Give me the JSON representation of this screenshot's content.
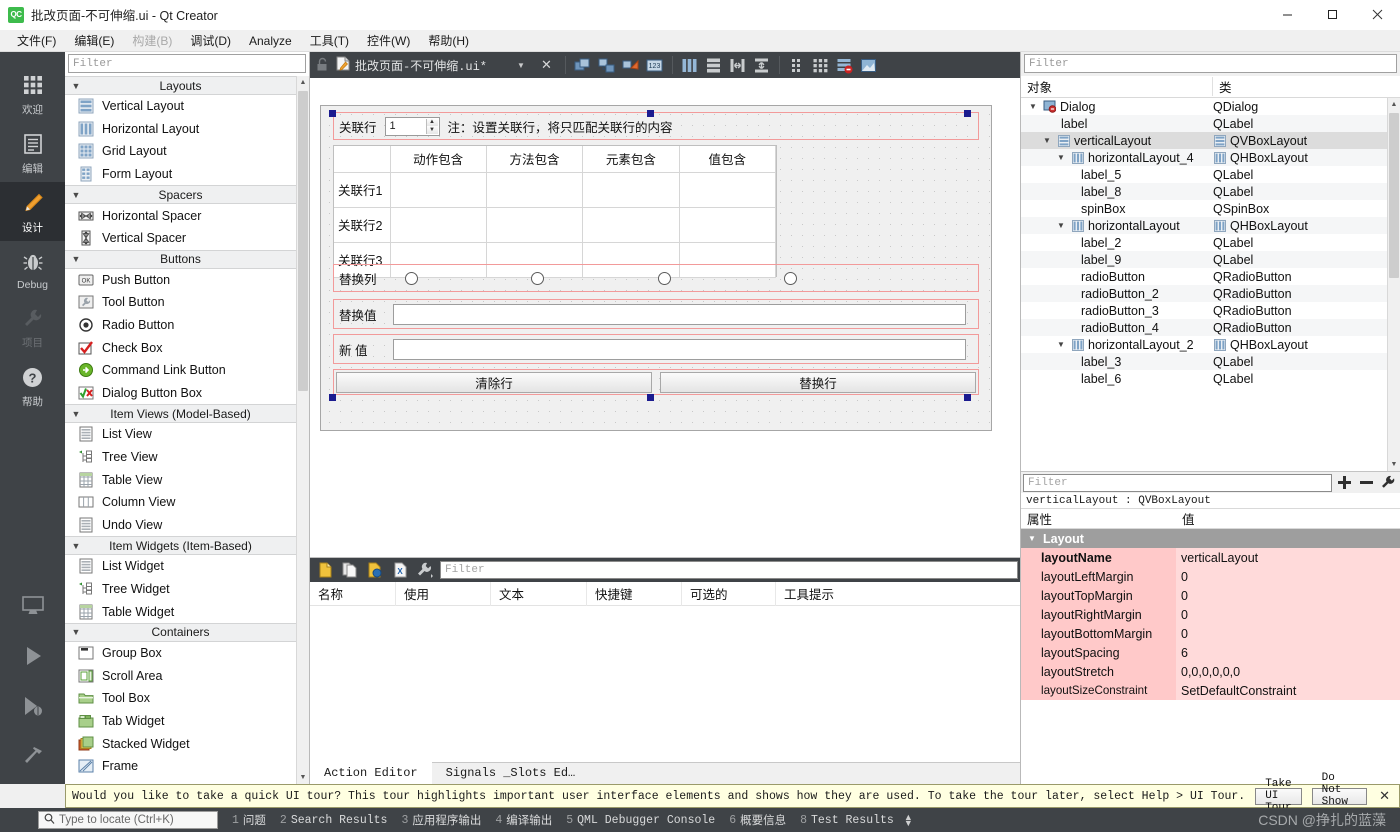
{
  "window": {
    "title": "批改页面-不可伸缩.ui - Qt Creator",
    "app_icon": "qt-creator-icon",
    "minimize": "—",
    "maximize": "▢",
    "close": "✕"
  },
  "menubar": {
    "items": [
      {
        "label": "文件(F)",
        "disabled": false
      },
      {
        "label": "编辑(E)",
        "disabled": false
      },
      {
        "label": "构建(B)",
        "disabled": true
      },
      {
        "label": "调试(D)",
        "disabled": false
      },
      {
        "label": "Analyze",
        "disabled": false
      },
      {
        "label": "工具(T)",
        "disabled": false
      },
      {
        "label": "控件(W)",
        "disabled": false
      },
      {
        "label": "帮助(H)",
        "disabled": false
      }
    ]
  },
  "modebar": {
    "items": [
      {
        "label": "欢迎",
        "icon": "grid-icon",
        "state": "normal"
      },
      {
        "label": "编辑",
        "icon": "document-icon",
        "state": "normal"
      },
      {
        "label": "设计",
        "icon": "pencil-icon",
        "state": "active"
      },
      {
        "label": "Debug",
        "icon": "bug-icon",
        "state": "normal"
      },
      {
        "label": "项目",
        "icon": "wrench-icon",
        "state": "disabled"
      },
      {
        "label": "帮助",
        "icon": "question-icon",
        "state": "normal"
      }
    ],
    "bottom": [
      {
        "icon": "kit-monitor-icon",
        "label": "kit-selector"
      },
      {
        "icon": "run-play-icon",
        "label": "run"
      },
      {
        "icon": "debug-play-icon",
        "label": "start-debugging"
      },
      {
        "icon": "hammer-icon",
        "label": "build"
      }
    ]
  },
  "widget_box": {
    "filter_placeholder": "Filter",
    "filter_value": "",
    "categories": [
      {
        "name": "Layouts",
        "expanded": true,
        "items": [
          {
            "label": "Vertical Layout",
            "icon": "vertical-layout-icon"
          },
          {
            "label": "Horizontal Layout",
            "icon": "horizontal-layout-icon"
          },
          {
            "label": "Grid Layout",
            "icon": "grid-layout-icon"
          },
          {
            "label": "Form Layout",
            "icon": "form-layout-icon"
          }
        ]
      },
      {
        "name": "Spacers",
        "expanded": true,
        "items": [
          {
            "label": "Horizontal Spacer",
            "icon": "horizontal-spacer-icon"
          },
          {
            "label": "Vertical Spacer",
            "icon": "vertical-spacer-icon"
          }
        ]
      },
      {
        "name": "Buttons",
        "expanded": true,
        "items": [
          {
            "label": "Push Button",
            "icon": "push-button-icon"
          },
          {
            "label": "Tool Button",
            "icon": "tool-button-icon"
          },
          {
            "label": "Radio Button",
            "icon": "radio-button-icon"
          },
          {
            "label": "Check Box",
            "icon": "check-box-icon"
          },
          {
            "label": "Command Link Button",
            "icon": "command-link-icon"
          },
          {
            "label": "Dialog Button Box",
            "icon": "dialog-button-box-icon"
          }
        ]
      },
      {
        "name": "Item Views (Model-Based)",
        "expanded": true,
        "items": [
          {
            "label": "List View",
            "icon": "list-view-icon"
          },
          {
            "label": "Tree View",
            "icon": "tree-view-icon"
          },
          {
            "label": "Table View",
            "icon": "table-view-icon"
          },
          {
            "label": "Column View",
            "icon": "column-view-icon"
          },
          {
            "label": "Undo View",
            "icon": "undo-view-icon"
          }
        ]
      },
      {
        "name": "Item Widgets (Item-Based)",
        "expanded": true,
        "items": [
          {
            "label": "List Widget",
            "icon": "list-widget-icon"
          },
          {
            "label": "Tree Widget",
            "icon": "tree-widget-icon"
          },
          {
            "label": "Table Widget",
            "icon": "table-widget-icon"
          }
        ]
      },
      {
        "name": "Containers",
        "expanded": true,
        "items": [
          {
            "label": "Group Box",
            "icon": "group-box-icon"
          },
          {
            "label": "Scroll Area",
            "icon": "scroll-area-icon"
          },
          {
            "label": "Tool Box",
            "icon": "tool-box-icon"
          },
          {
            "label": "Tab Widget",
            "icon": "tab-widget-icon"
          },
          {
            "label": "Stacked Widget",
            "icon": "stacked-widget-icon"
          },
          {
            "label": "Frame",
            "icon": "frame-icon"
          }
        ]
      }
    ]
  },
  "doc_toolbar": {
    "lock_icon": "unlocked-icon",
    "file_icon": "ui-file-icon",
    "filename": "批改页面-不可伸缩.ui*",
    "dropdown_icon": "chevron-down-icon",
    "close_icon": "close-icon",
    "tools": [
      {
        "icon": "edit-widgets-icon",
        "name": "edit-widgets"
      },
      {
        "icon": "edit-signals-slots-icon",
        "name": "edit-signals-slots"
      },
      {
        "icon": "edit-buddies-icon",
        "name": "edit-buddies"
      },
      {
        "icon": "edit-tab-order-icon",
        "name": "edit-tab-order"
      },
      {
        "icon": "layout-horizontally-icon",
        "name": "lay-out-horizontally"
      },
      {
        "icon": "layout-vertically-icon",
        "name": "lay-out-vertically"
      },
      {
        "icon": "layout-splitter-h-icon",
        "name": "lay-out-in-splitter-horizontally"
      },
      {
        "icon": "layout-splitter-v-icon",
        "name": "lay-out-in-splitter-vertically"
      },
      {
        "icon": "layout-form-icon",
        "name": "lay-out-in-form-layout"
      },
      {
        "icon": "layout-grid-icon",
        "name": "lay-out-in-grid"
      },
      {
        "icon": "break-layout-icon",
        "name": "break-layout"
      },
      {
        "icon": "adjust-size-icon",
        "name": "adjust-size"
      }
    ]
  },
  "form": {
    "assoc_row_label": "关联行",
    "spin_value": "1",
    "note_label": "注：设置关联行，将只匹配关联行的内容",
    "table": {
      "corner": "",
      "columns": [
        "动作包含",
        "方法包含",
        "元素包含",
        "值包含"
      ],
      "rows": [
        {
          "header": "关联行1",
          "cells": [
            "",
            "",
            "",
            ""
          ]
        },
        {
          "header": "关联行2",
          "cells": [
            "",
            "",
            "",
            ""
          ]
        },
        {
          "header": "关联行3",
          "cells": [
            "",
            "",
            "",
            ""
          ]
        }
      ]
    },
    "replace_col_label": "替换列",
    "radios": [
      {
        "name": "radioButton",
        "checked": false
      },
      {
        "name": "radioButton_2",
        "checked": false
      },
      {
        "name": "radioButton_3",
        "checked": false
      },
      {
        "name": "radioButton_4",
        "checked": false
      }
    ],
    "replace_value_label": "替换值",
    "replace_value": "",
    "new_value_label": "新  值",
    "new_value": "",
    "clear_button": "清除行",
    "replace_button": "替换行"
  },
  "action_editor": {
    "toolbar": [
      {
        "icon": "new-action-icon",
        "name": "new-action"
      },
      {
        "icon": "copy-action-icon",
        "name": "copy"
      },
      {
        "icon": "edit-action-icon",
        "name": "edit-action"
      },
      {
        "icon": "delete-action-icon",
        "name": "delete"
      },
      {
        "icon": "configure-icon",
        "name": "configure"
      }
    ],
    "filter_placeholder": "Filter",
    "filter_value": "",
    "columns": [
      "名称",
      "使用",
      "文本",
      "快捷键",
      "可选的",
      "工具提示"
    ],
    "rows": [],
    "tabs": [
      {
        "label": "Action Editor",
        "active": true
      },
      {
        "label": "Signals _Slots Ed…",
        "active": false
      }
    ]
  },
  "object_inspector": {
    "filter_placeholder": "Filter",
    "filter_value": "",
    "columns": [
      "对象",
      "类"
    ],
    "rows": [
      {
        "indent": 0,
        "twisty": "v",
        "icon": "dialog-icon",
        "name": "Dialog",
        "class_icon": "",
        "class": "QDialog",
        "selected": false
      },
      {
        "indent": 2,
        "twisty": "",
        "icon": "",
        "name": "label",
        "class_icon": "",
        "class": "QLabel",
        "selected": false
      },
      {
        "indent": 1,
        "twisty": "v",
        "icon": "vbox-icon",
        "name": "verticalLayout",
        "class_icon": "vbox-icon",
        "class": "QVBoxLayout",
        "selected": true
      },
      {
        "indent": 2,
        "twisty": "v",
        "icon": "hbox-icon",
        "name": "horizontalLayout_4",
        "class_icon": "hbox-icon",
        "class": "QHBoxLayout",
        "selected": false
      },
      {
        "indent": 3,
        "twisty": "",
        "icon": "",
        "name": "label_5",
        "class_icon": "",
        "class": "QLabel",
        "selected": false
      },
      {
        "indent": 3,
        "twisty": "",
        "icon": "",
        "name": "label_8",
        "class_icon": "",
        "class": "QLabel",
        "selected": false
      },
      {
        "indent": 3,
        "twisty": "",
        "icon": "",
        "name": "spinBox",
        "class_icon": "",
        "class": "QSpinBox",
        "selected": false
      },
      {
        "indent": 2,
        "twisty": "v",
        "icon": "hbox-icon",
        "name": "horizontalLayout",
        "class_icon": "hbox-icon",
        "class": "QHBoxLayout",
        "selected": false
      },
      {
        "indent": 3,
        "twisty": "",
        "icon": "",
        "name": "label_2",
        "class_icon": "",
        "class": "QLabel",
        "selected": false
      },
      {
        "indent": 3,
        "twisty": "",
        "icon": "",
        "name": "label_9",
        "class_icon": "",
        "class": "QLabel",
        "selected": false
      },
      {
        "indent": 3,
        "twisty": "",
        "icon": "",
        "name": "radioButton",
        "class_icon": "",
        "class": "QRadioButton",
        "selected": false
      },
      {
        "indent": 3,
        "twisty": "",
        "icon": "",
        "name": "radioButton_2",
        "class_icon": "",
        "class": "QRadioButton",
        "selected": false
      },
      {
        "indent": 3,
        "twisty": "",
        "icon": "",
        "name": "radioButton_3",
        "class_icon": "",
        "class": "QRadioButton",
        "selected": false
      },
      {
        "indent": 3,
        "twisty": "",
        "icon": "",
        "name": "radioButton_4",
        "class_icon": "",
        "class": "QRadioButton",
        "selected": false
      },
      {
        "indent": 2,
        "twisty": "v",
        "icon": "hbox-icon",
        "name": "horizontalLayout_2",
        "class_icon": "hbox-icon",
        "class": "QHBoxLayout",
        "selected": false
      },
      {
        "indent": 3,
        "twisty": "",
        "icon": "",
        "name": "label_3",
        "class_icon": "",
        "class": "QLabel",
        "selected": false
      },
      {
        "indent": 3,
        "twisty": "",
        "icon": "",
        "name": "label_6",
        "class_icon": "",
        "class": "QLabel",
        "selected": false
      }
    ]
  },
  "property_editor": {
    "filter_placeholder": "Filter",
    "filter_value": "",
    "buttons": [
      {
        "icon": "plus-icon",
        "name": "add-dynamic-property"
      },
      {
        "icon": "minus-icon",
        "name": "remove-dynamic-property"
      },
      {
        "icon": "configure-icon",
        "name": "configure"
      }
    ],
    "object_line": "verticalLayout : QVBoxLayout",
    "columns": [
      "属性",
      "值"
    ],
    "group": "Layout",
    "rows": [
      {
        "key": "layoutName",
        "value": "verticalLayout",
        "bold": true
      },
      {
        "key": "layoutLeftMargin",
        "value": "0",
        "bold": false
      },
      {
        "key": "layoutTopMargin",
        "value": "0",
        "bold": false
      },
      {
        "key": "layoutRightMargin",
        "value": "0",
        "bold": false
      },
      {
        "key": "layoutBottomMargin",
        "value": "0",
        "bold": false
      },
      {
        "key": "layoutSpacing",
        "value": "6",
        "bold": false
      },
      {
        "key": "layoutStretch",
        "value": "0,0,0,0,0,0",
        "bold": false
      },
      {
        "key": "layoutSizeConstraint",
        "value": "SetDefaultConstraint",
        "bold": false
      }
    ]
  },
  "tourbar": {
    "message": "Would you like to take a quick UI tour? This tour highlights important user interface elements and shows how they are used. To take the tour later, select Help > UI Tour.",
    "take_tour": "Take UI Tour",
    "dont_show": "Do Not Show Again",
    "close_icon": "✕"
  },
  "statusbar": {
    "locate_placeholder": "Type to locate (Ctrl+K)",
    "locate_value": "",
    "search_icon": "search-icon",
    "panes": [
      {
        "num": "1",
        "label": "问题"
      },
      {
        "num": "2",
        "label": "Search Results"
      },
      {
        "num": "3",
        "label": "应用程序输出"
      },
      {
        "num": "4",
        "label": "编译输出"
      },
      {
        "num": "5",
        "label": "QML Debugger Console"
      },
      {
        "num": "6",
        "label": "概要信息"
      },
      {
        "num": "8",
        "label": "Test Results"
      }
    ],
    "watermark": "CSDN @挣扎的蓝藻"
  },
  "colors": {
    "dark_chrome": "#3f4347",
    "accent_selection": "#f29a9a",
    "property_key_bg": "#ffc9c9",
    "property_value_bg": "#ffdada",
    "active_mode": "#2c2f33",
    "tour_bg": "#ffffe1"
  }
}
